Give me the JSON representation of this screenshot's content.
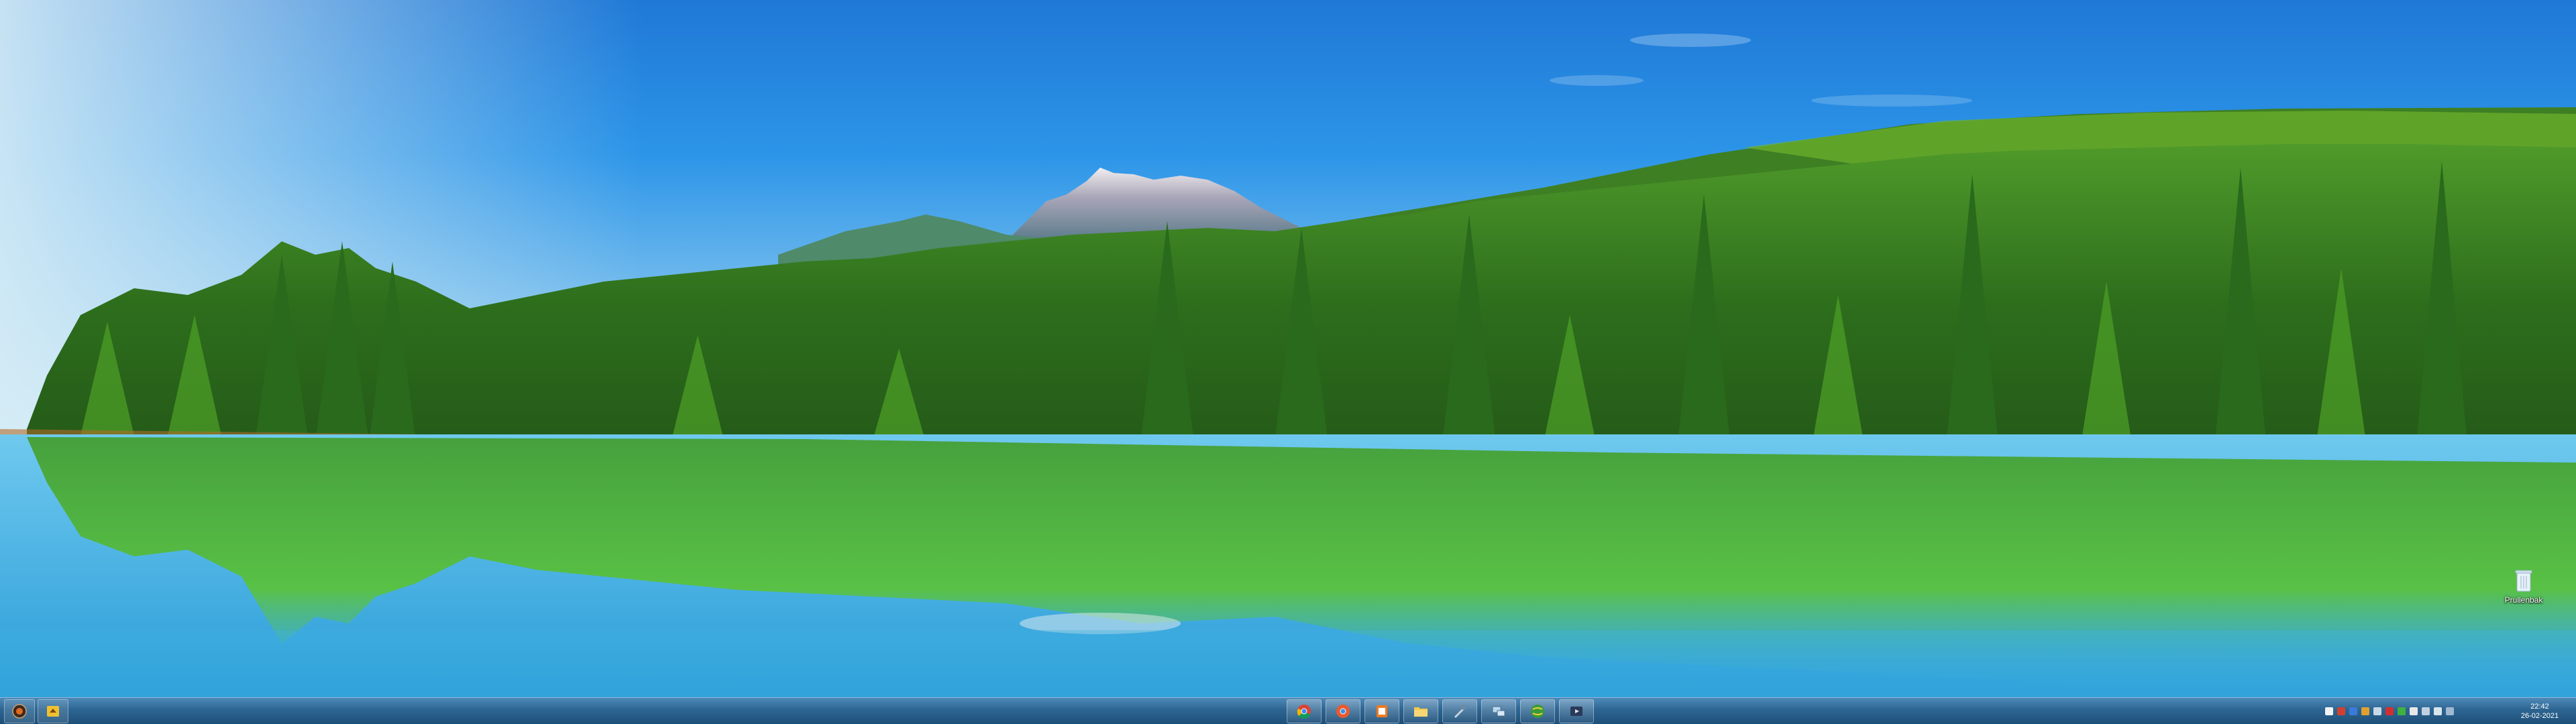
{
  "desktop": {
    "icons": [
      {
        "label": "Prullenbak",
        "icon": "recycle-bin-icon"
      }
    ]
  },
  "taskbar": {
    "left_buttons": [
      {
        "icon": "start-orb-icon"
      },
      {
        "icon": "pinned-app-icon"
      }
    ],
    "center_buttons": [
      {
        "icon": "chrome-icon"
      },
      {
        "icon": "chrome-alt-icon"
      },
      {
        "icon": "office-icon"
      },
      {
        "icon": "file-explorer-icon"
      },
      {
        "icon": "tools-icon"
      },
      {
        "icon": "network-icon"
      },
      {
        "icon": "globe-icon"
      },
      {
        "icon": "media-icon"
      }
    ],
    "tray_icons": [
      "tray-flag-icon",
      "tray-shield-icon",
      "tray-update-icon",
      "tray-app-icon",
      "tray-sync-icon",
      "tray-chat-icon",
      "tray-security-icon",
      "tray-battery-icon",
      "tray-network-icon",
      "tray-volume-icon",
      "tray-app2-icon"
    ],
    "clock": {
      "time": "22:42",
      "date": "26-02-2021"
    }
  },
  "colors": {
    "sky_top": "#1e7fe0",
    "sky_bottom": "#9fd6f0",
    "forest": "#2e7d22",
    "water": "#3fb2e0",
    "taskbar": "#2d6592"
  }
}
